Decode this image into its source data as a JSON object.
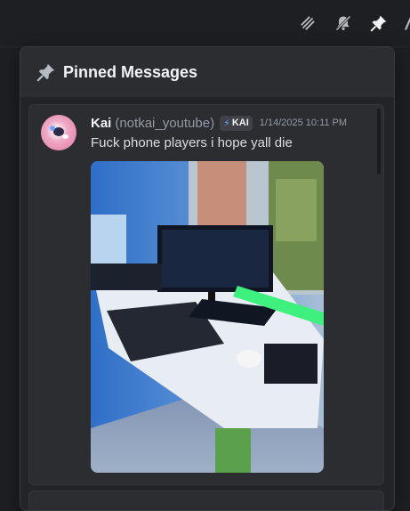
{
  "toolbar": {
    "icons": [
      "threads-icon",
      "notifications-muted-icon",
      "pinned-messages-icon",
      "members-icon"
    ]
  },
  "panel": {
    "title": "Pinned Messages"
  },
  "message": {
    "author": "Kai",
    "handle": "(notkai_youtube)",
    "tag": "KAI",
    "tag_icon": "⚡",
    "timestamp": "1/14/2025 10:11 PM",
    "text": "Fuck phone players i hope yall die",
    "attachment_icon": "photo-of-gaming-desk-setup"
  },
  "colors": {
    "background": "#1e1f22",
    "panel": "#2b2d31",
    "accent_tag": "#5aa8ff"
  }
}
